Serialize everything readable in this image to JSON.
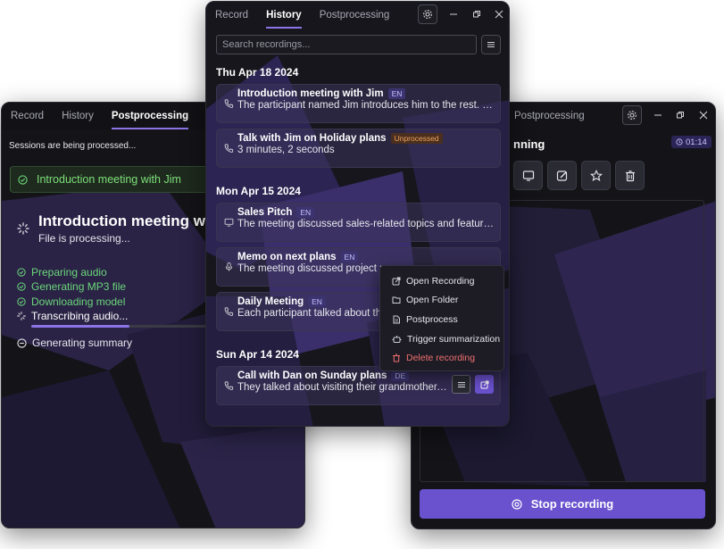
{
  "left_window": {
    "tabs": [
      {
        "label": "Record",
        "active": false
      },
      {
        "label": "History",
        "active": false
      },
      {
        "label": "Postprocessing",
        "active": true
      }
    ],
    "sessions_note": "Sessions are being processed...",
    "completed_session": "Introduction meeting with Jim",
    "processing": {
      "title": "Introduction meeting wi",
      "subtitle": "File is processing...",
      "steps": [
        {
          "label": "Preparing audio",
          "state": "done"
        },
        {
          "label": "Generating MP3 file",
          "state": "done"
        },
        {
          "label": "Downloading model",
          "state": "done"
        },
        {
          "label": "Transcribing audio...",
          "state": "active"
        }
      ],
      "progress_fraction": 0.55,
      "pending_step": "Generating summary"
    }
  },
  "center_window": {
    "tabs": [
      {
        "label": "Record",
        "active": false
      },
      {
        "label": "History",
        "active": true
      },
      {
        "label": "Postprocessing",
        "active": false
      }
    ],
    "search_placeholder": "Search recordings...",
    "groups": [
      {
        "date": "Thu Apr 18 2024",
        "items": [
          {
            "title": "Introduction meeting with Jim",
            "badge": "EN",
            "badge_type": "lang",
            "desc": "The participant named Jim introduces him to the rest. - ...",
            "icon": "phone-icon"
          },
          {
            "title": "Talk with Jim on Holiday plans",
            "badge": "Unprocessed",
            "badge_type": "warn",
            "desc": "3 minutes, 2 seconds",
            "icon": "phone-icon"
          }
        ]
      },
      {
        "date": "Mon Apr 15 2024",
        "items": [
          {
            "title": "Sales Pitch",
            "badge": "EN",
            "badge_type": "lang",
            "desc": "The meeting discussed sales-related topics and featured...",
            "icon": "monitor-icon"
          },
          {
            "title": "Memo on next plans",
            "badge": "EN",
            "badge_type": "lang",
            "desc": "The meeting discussed project p",
            "icon": "microphone-icon"
          },
          {
            "title": "Daily Meeting",
            "badge": "EN",
            "badge_type": "lang",
            "desc": "Each participant talked about the",
            "icon": "phone-icon"
          }
        ]
      },
      {
        "date": "Sun Apr 14 2024",
        "items": [
          {
            "title": "Call with Dan on Sunday plans",
            "badge": "DE",
            "badge_type": "lang",
            "desc": "They talked about visiting their grandmother....",
            "icon": "phone-icon"
          }
        ]
      }
    ],
    "context_menu": [
      {
        "label": "Open Recording",
        "icon": "external-link-icon",
        "danger": false
      },
      {
        "label": "Open Folder",
        "icon": "folder-icon",
        "danger": false
      },
      {
        "label": "Postprocess",
        "icon": "file-icon",
        "danger": false
      },
      {
        "label": "Trigger summarization",
        "icon": "robot-icon",
        "danger": false
      },
      {
        "label": "Delete recording",
        "icon": "trash-icon",
        "danger": true
      }
    ]
  },
  "right_window": {
    "tabs": [
      {
        "label": "Postprocessing",
        "active": false
      }
    ],
    "recording_title": "nning",
    "timer": "01:14",
    "stop_button": "Stop recording"
  },
  "colors": {
    "accent": "#6a52cf",
    "success": "#6bd67a",
    "danger": "#f07070",
    "warning": "#f1a35a"
  }
}
